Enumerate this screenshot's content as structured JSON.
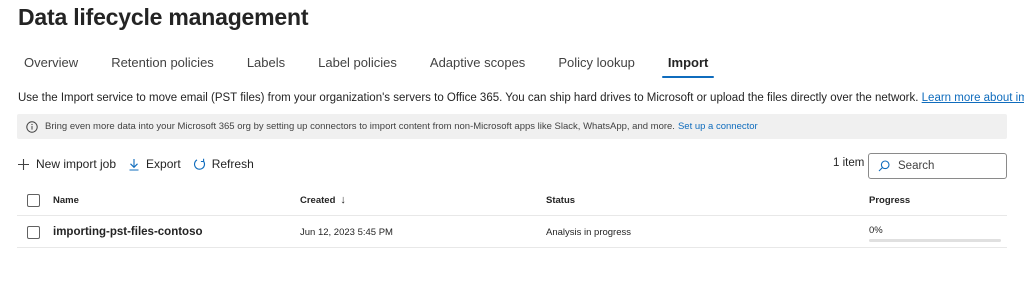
{
  "page": {
    "title": "Data lifecycle management"
  },
  "tabs": [
    {
      "label": "Overview"
    },
    {
      "label": "Retention policies"
    },
    {
      "label": "Labels"
    },
    {
      "label": "Label policies"
    },
    {
      "label": "Adaptive scopes"
    },
    {
      "label": "Policy lookup"
    },
    {
      "label": "Import",
      "active": true
    }
  ],
  "description": {
    "text": "Use the Import service to move email (PST files) from your organization's servers to Office 365. You can ship hard drives to Microsoft or upload the files directly over the network.",
    "link": "Learn more about import"
  },
  "info_bar": {
    "icon": "info-icon",
    "text": "Bring even more data into your Microsoft 365 org by setting up connectors to import content from non-Microsoft apps like Slack, WhatsApp, and more.",
    "link": "Set up a connector"
  },
  "toolbar": {
    "new_job": "New import job",
    "export": "Export",
    "refresh": "Refresh",
    "item_count": "1 item"
  },
  "search": {
    "placeholder": "Search"
  },
  "table": {
    "columns": {
      "name": "Name",
      "created": "Created",
      "created_sort": "↓",
      "status": "Status",
      "progress": "Progress"
    },
    "rows": [
      {
        "name": "importing-pst-files-contoso",
        "created": "Jun 12, 2023 5:45 PM",
        "status": "Analysis in progress",
        "progress": "0%",
        "progress_value": 0
      }
    ]
  },
  "colors": {
    "accent": "#0f6cbd",
    "info_bg": "#f0f0f0",
    "text": "#242424"
  }
}
